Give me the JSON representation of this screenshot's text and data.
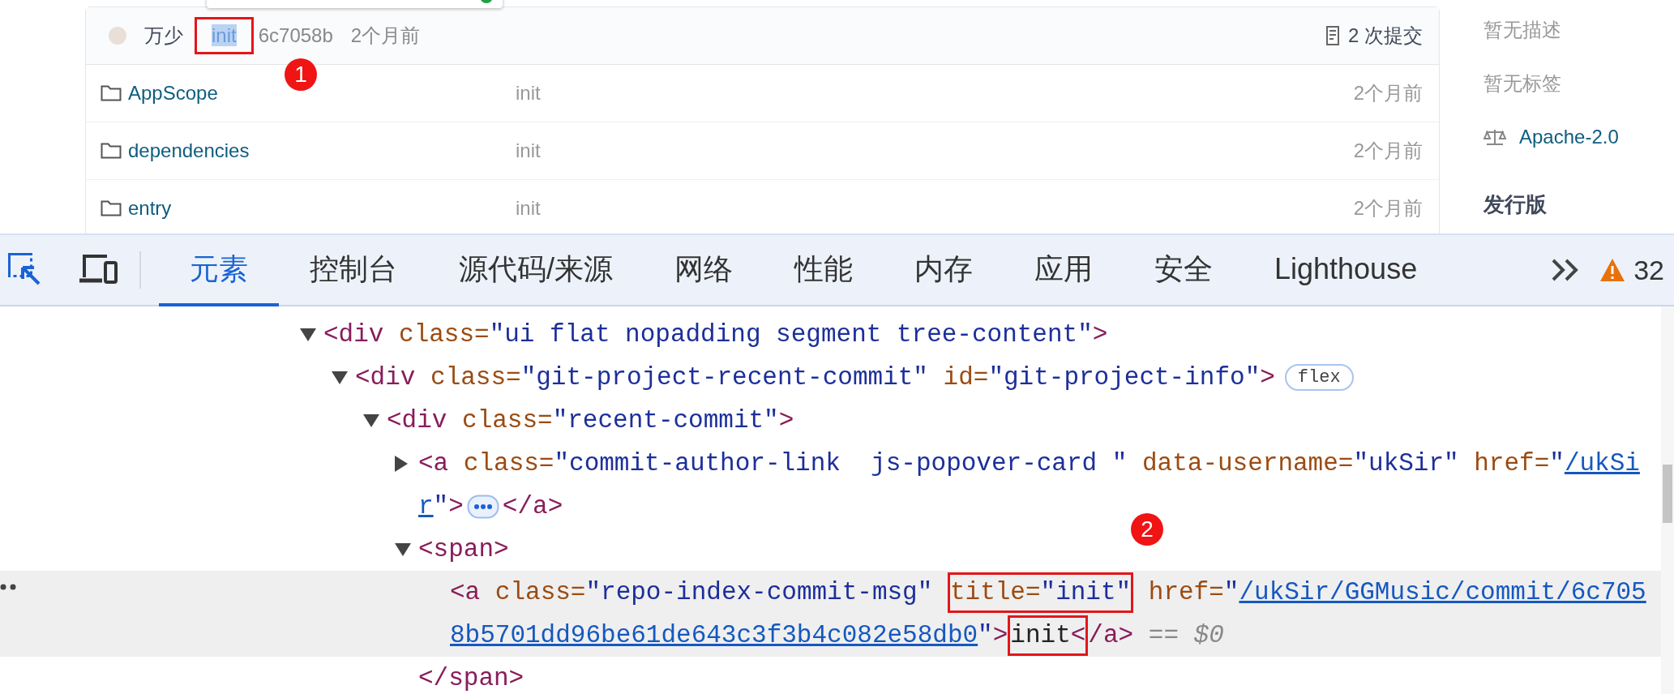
{
  "repo_page": {
    "latest_commit": {
      "author": "万少",
      "message": "init",
      "message_highlighted": true,
      "message_boxed": true,
      "hash": "6c7058b",
      "time": "2个月前",
      "commits": "2 次提交",
      "step_badge": "1"
    },
    "files": [
      {
        "name": "AppScope",
        "message": "init",
        "time": "2个月前"
      },
      {
        "name": "dependencies",
        "message": "init",
        "time": "2个月前"
      },
      {
        "name": "entry",
        "message": "init",
        "time": "2个月前"
      }
    ],
    "sidebar": {
      "description": "暂无描述",
      "tags": "暂无标签",
      "license": "Apache-2.0",
      "releases_heading": "发行版"
    }
  },
  "devtools": {
    "tabs": [
      {
        "label": "元素",
        "selected": true
      },
      {
        "label": "控制台",
        "selected": false
      },
      {
        "label": "源代码/来源",
        "selected": false
      },
      {
        "label": "网络",
        "selected": false
      },
      {
        "label": "性能",
        "selected": false
      },
      {
        "label": "内存",
        "selected": false
      },
      {
        "label": "应用",
        "selected": false
      },
      {
        "label": "安全",
        "selected": false
      },
      {
        "label": "Lighthouse",
        "selected": false
      }
    ],
    "warning_count": "32",
    "step_badge": "2",
    "elements_tree": [
      {
        "expandable": true,
        "expanded": true,
        "selected": false,
        "lines": [
          [
            {
              "kind": "tag",
              "text": "<div"
            },
            {
              "kind": "attr",
              "text": " class="
            },
            {
              "kind": "value",
              "text": "\"ui flat nopadding segment tree-content\""
            },
            {
              "kind": "tag",
              "text": ">"
            }
          ]
        ],
        "children": [
          {
            "expandable": true,
            "expanded": true,
            "selected": false,
            "lines": [
              [
                {
                  "kind": "tag",
                  "text": "<div"
                },
                {
                  "kind": "attr",
                  "text": " class="
                },
                {
                  "kind": "value",
                  "text": "\"git-project-recent-commit\""
                },
                {
                  "kind": "attr",
                  "text": " id="
                },
                {
                  "kind": "value",
                  "text": "\"git-project-info\""
                },
                {
                  "kind": "tag",
                  "text": ">"
                },
                {
                  "kind": "pill",
                  "text": "flex"
                }
              ]
            ],
            "children": [
              {
                "expandable": true,
                "expanded": true,
                "selected": false,
                "lines": [
                  [
                    {
                      "kind": "tag",
                      "text": "<div"
                    },
                    {
                      "kind": "attr",
                      "text": " class="
                    },
                    {
                      "kind": "value",
                      "text": "\"recent-commit\""
                    },
                    {
                      "kind": "tag",
                      "text": ">"
                    }
                  ]
                ],
                "children": [
                  {
                    "expandable": true,
                    "expanded": false,
                    "selected": false,
                    "lines": [
                      [
                        {
                          "kind": "tag",
                          "text": "<a"
                        },
                        {
                          "kind": "attr",
                          "text": " class="
                        },
                        {
                          "kind": "value",
                          "text": "\"commit-author-link  js-popover-card \""
                        },
                        {
                          "kind": "attr",
                          "text": " data-username="
                        },
                        {
                          "kind": "value",
                          "text": "\"ukSir\""
                        },
                        {
                          "kind": "attr",
                          "text": " href="
                        },
                        {
                          "kind": "value",
                          "text": "\""
                        },
                        {
                          "kind": "link",
                          "text": "/ukSi"
                        }
                      ],
                      [
                        {
                          "kind": "link",
                          "text": "r"
                        },
                        {
                          "kind": "value",
                          "text": "\""
                        },
                        {
                          "kind": "tag",
                          "text": ">"
                        },
                        {
                          "kind": "ellipsis"
                        },
                        {
                          "kind": "tag",
                          "text": "</a>"
                        }
                      ]
                    ]
                  },
                  {
                    "expandable": true,
                    "expanded": true,
                    "selected": false,
                    "lines": [
                      [
                        {
                          "kind": "tag",
                          "text": "<span>"
                        }
                      ]
                    ],
                    "children": [
                      {
                        "expandable": false,
                        "selected": true,
                        "lines": [
                          [
                            {
                              "kind": "tag",
                              "text": "<a"
                            },
                            {
                              "kind": "attr",
                              "text": " class="
                            },
                            {
                              "kind": "value",
                              "text": "\"repo-index-commit-msg\" "
                            },
                            {
                              "kind": "boxed",
                              "tokens": [
                                {
                                  "kind": "attr",
                                  "text": "title="
                                },
                                {
                                  "kind": "value",
                                  "text": "\"init\""
                                }
                              ]
                            },
                            {
                              "kind": "attr",
                              "text": " href="
                            },
                            {
                              "kind": "value",
                              "text": "\""
                            },
                            {
                              "kind": "link",
                              "text": "/ukSir/GGMusic/commit/6c705"
                            }
                          ],
                          [
                            {
                              "kind": "link",
                              "text": "8b5701dd96be61de643c3f3b4c082e58db0"
                            },
                            {
                              "kind": "value",
                              "text": "\""
                            },
                            {
                              "kind": "tag",
                              "text": ">"
                            },
                            {
                              "kind": "boxed",
                              "tokens": [
                                {
                                  "kind": "text",
                                  "text": "init"
                                },
                                {
                                  "kind": "tag",
                                  "text": "<"
                                }
                              ]
                            },
                            {
                              "kind": "tag",
                              "text": "/a>"
                            },
                            {
                              "kind": "ref",
                              "text": " == $0"
                            }
                          ]
                        ]
                      }
                    ],
                    "closing": [
                      {
                        "kind": "tag",
                        "text": "</span>"
                      }
                    ]
                  }
                ]
              }
            ]
          }
        ]
      }
    ]
  }
}
